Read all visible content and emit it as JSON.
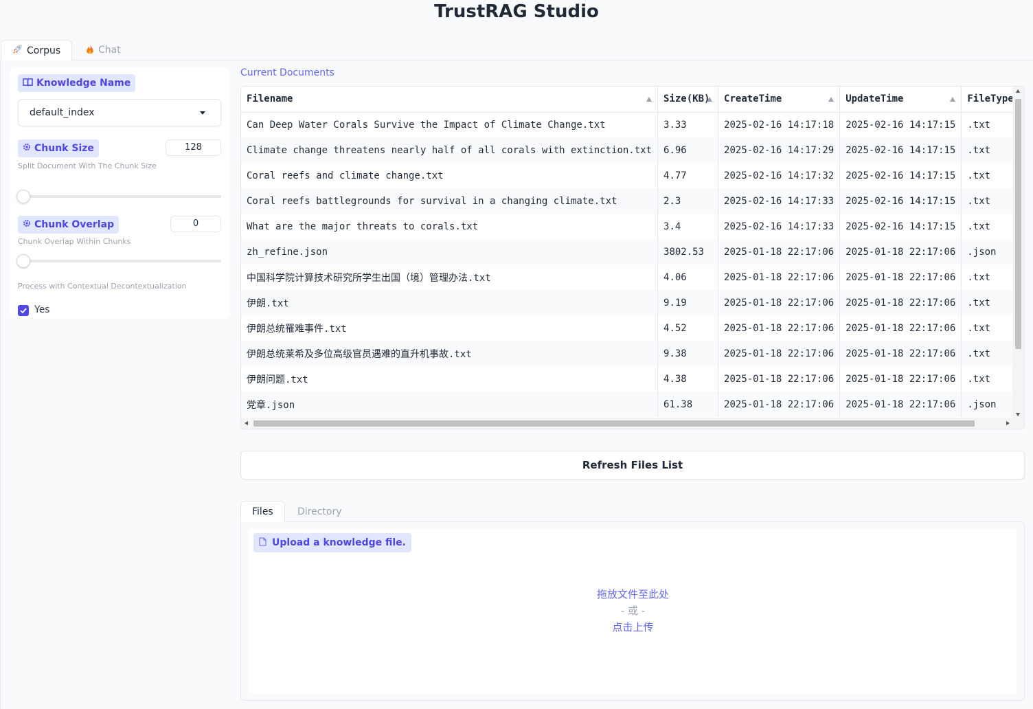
{
  "app": {
    "title": "TrustRAG Studio"
  },
  "tabs": [
    {
      "label": "Corpus",
      "icon": "rocket-icon",
      "active": true
    },
    {
      "label": "Chat",
      "icon": "fire-icon",
      "active": false
    }
  ],
  "sidebar": {
    "knowledge_name": {
      "label": "Knowledge Name",
      "icon": "book-icon",
      "value": "default_index"
    },
    "chunk_size": {
      "label": "Chunk Size",
      "icon": "gear-icon",
      "value": "128",
      "info": "Split Document With The Chunk Size",
      "slider_level": 0
    },
    "chunk_overlap": {
      "label": "Chunk Overlap",
      "icon": "gear-icon",
      "value": "0",
      "info": "Chunk Overlap Within Chunks",
      "slider_level": 0
    },
    "decontext": {
      "label": "Process with Contextual Decontextualization",
      "checkbox_label": "Yes",
      "checked": true
    }
  },
  "documents": {
    "title": "Current Documents",
    "columns": [
      "Filename",
      "Size(KB)",
      "CreateTime",
      "UpdateTime",
      "FileType"
    ],
    "rows": [
      [
        "Can Deep Water Corals Survive the Impact of Climate Change.txt",
        "3.33",
        "2025-02-16 14:17:18",
        "2025-02-16 14:17:15",
        ".txt"
      ],
      [
        "Climate change threatens nearly half of all corals with extinction.txt",
        "6.96",
        "2025-02-16 14:17:29",
        "2025-02-16 14:17:15",
        ".txt"
      ],
      [
        "Coral reefs and climate change.txt",
        "4.77",
        "2025-02-16 14:17:32",
        "2025-02-16 14:17:15",
        ".txt"
      ],
      [
        "Coral reefs battlegrounds for survival in a changing climate.txt",
        "2.3",
        "2025-02-16 14:17:33",
        "2025-02-16 14:17:15",
        ".txt"
      ],
      [
        "What are the major threats to corals.txt",
        "3.4",
        "2025-02-16 14:17:33",
        "2025-02-16 14:17:15",
        ".txt"
      ],
      [
        "zh_refine.json",
        "3802.53",
        "2025-01-18 22:17:06",
        "2025-01-18 22:17:06",
        ".json"
      ],
      [
        "中国科学院计算技术研究所学生出国（境）管理办法.txt",
        "4.06",
        "2025-01-18 22:17:06",
        "2025-01-18 22:17:06",
        ".txt"
      ],
      [
        "伊朗.txt",
        "9.19",
        "2025-01-18 22:17:06",
        "2025-01-18 22:17:06",
        ".txt"
      ],
      [
        "伊朗总统罹难事件.txt",
        "4.52",
        "2025-01-18 22:17:06",
        "2025-01-18 22:17:06",
        ".txt"
      ],
      [
        "伊朗总统莱希及多位高级官员遇难的直升机事故.txt",
        "9.38",
        "2025-01-18 22:17:06",
        "2025-01-18 22:17:06",
        ".txt"
      ],
      [
        "伊朗问题.txt",
        "4.38",
        "2025-01-18 22:17:06",
        "2025-01-18 22:17:06",
        ".txt"
      ],
      [
        "党章.json",
        "61.38",
        "2025-01-18 22:17:06",
        "2025-01-18 22:17:06",
        ".json"
      ]
    ]
  },
  "refresh_button": "Refresh Files List",
  "upload": {
    "tabs": [
      {
        "label": "Files",
        "active": true
      },
      {
        "label": "Directory",
        "active": false
      }
    ],
    "label": "Upload a knowledge file.",
    "drop_text": "拖放文件至此处",
    "or_text": "- 或 -",
    "click_text": "点击上传"
  },
  "colors": {
    "accent": "#4f46e5",
    "accent_bg": "#e0e7ff",
    "link": "#6366f1"
  }
}
